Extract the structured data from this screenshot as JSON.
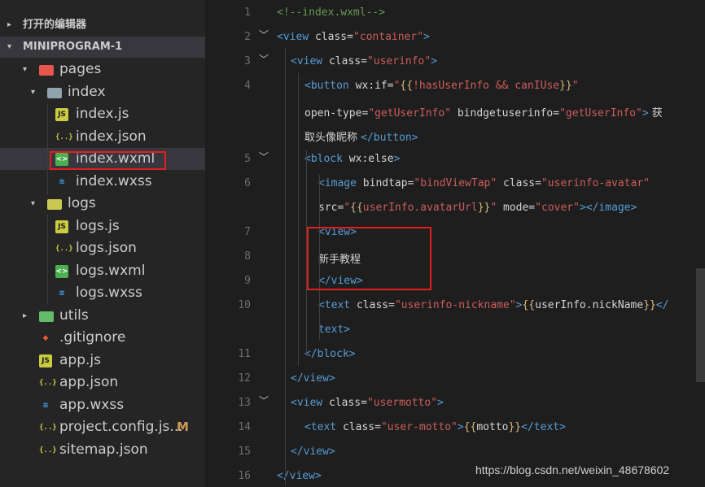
{
  "sidebar": {
    "open_editors_label": "打开的编辑器",
    "project_label": "MINIPROGRAM-1",
    "tree": [
      {
        "name": "pages",
        "kind": "folder-pages",
        "depth": 0,
        "arrow": "▾"
      },
      {
        "name": "index",
        "kind": "folder-index",
        "depth": 1,
        "arrow": "▾"
      },
      {
        "name": "index.js",
        "kind": "js",
        "depth": 2
      },
      {
        "name": "index.json",
        "kind": "json",
        "depth": 2
      },
      {
        "name": "index.wxml",
        "kind": "wxml",
        "depth": 2,
        "selected": true
      },
      {
        "name": "index.wxss",
        "kind": "css",
        "depth": 2
      },
      {
        "name": "logs",
        "kind": "folder-logs",
        "depth": 1,
        "arrow": "▾"
      },
      {
        "name": "logs.js",
        "kind": "js",
        "depth": 2
      },
      {
        "name": "logs.json",
        "kind": "json",
        "depth": 2
      },
      {
        "name": "logs.wxml",
        "kind": "wxml",
        "depth": 2
      },
      {
        "name": "logs.wxss",
        "kind": "css",
        "depth": 2
      },
      {
        "name": "utils",
        "kind": "folder-utils",
        "depth": 0,
        "arrow": "▸"
      },
      {
        "name": ".gitignore",
        "kind": "git",
        "depth": 0
      },
      {
        "name": "app.js",
        "kind": "js",
        "depth": 0
      },
      {
        "name": "app.json",
        "kind": "json",
        "depth": 0
      },
      {
        "name": "app.wxss",
        "kind": "css",
        "depth": 0
      },
      {
        "name": "project.config.js...",
        "kind": "json",
        "depth": 0,
        "badge": "M"
      },
      {
        "name": "sitemap.json",
        "kind": "json",
        "depth": 0
      }
    ]
  },
  "editor": {
    "lines": [
      {
        "num": "1",
        "fold": false,
        "indent": 0,
        "tokens": [
          [
            "c",
            "<!--index.wxml-->"
          ]
        ]
      },
      {
        "num": "2",
        "fold": true,
        "indent": 0,
        "tokens": [
          [
            "t",
            "<view "
          ],
          [
            "a",
            "class="
          ],
          [
            "s",
            "\"container\""
          ],
          [
            "t",
            ">"
          ]
        ]
      },
      {
        "num": "3",
        "fold": true,
        "indent": 1,
        "tokens": [
          [
            "t",
            "<view "
          ],
          [
            "a",
            "class="
          ],
          [
            "s",
            "\"userinfo\""
          ],
          [
            "t",
            ">"
          ]
        ]
      },
      {
        "num": "4",
        "fold": false,
        "indent": 2,
        "tokens": [
          [
            "t",
            "<button "
          ],
          [
            "a",
            "wx:if="
          ],
          [
            "s",
            "\""
          ],
          [
            "b",
            "{{"
          ],
          [
            "s",
            "!hasUserInfo && canIUse"
          ],
          [
            "b",
            "}}"
          ],
          [
            "s",
            "\""
          ]
        ]
      },
      {
        "num": "",
        "fold": false,
        "indent": 2,
        "tokens": [
          [
            "a",
            "open-type="
          ],
          [
            "s",
            "\"getUserInfo\""
          ],
          [
            "a",
            " bindgetuserinfo="
          ],
          [
            "s",
            "\"getUserInfo\""
          ],
          [
            "t",
            ">"
          ],
          [
            "x",
            " 获"
          ]
        ]
      },
      {
        "num": "",
        "fold": false,
        "indent": 2,
        "tokens": [
          [
            "x",
            "取头像昵称 "
          ],
          [
            "t",
            "</button>"
          ]
        ]
      },
      {
        "num": "5",
        "fold": true,
        "indent": 2,
        "tokens": [
          [
            "t",
            "<block "
          ],
          [
            "a",
            "wx:else"
          ],
          [
            "t",
            ">"
          ]
        ]
      },
      {
        "num": "6",
        "fold": false,
        "indent": 3,
        "tokens": [
          [
            "t",
            "<image "
          ],
          [
            "a",
            "bindtap="
          ],
          [
            "s",
            "\"bindViewTap\""
          ],
          [
            "a",
            " class="
          ],
          [
            "s",
            "\"userinfo-avatar\""
          ]
        ]
      },
      {
        "num": "",
        "fold": false,
        "indent": 3,
        "tokens": [
          [
            "a",
            "src="
          ],
          [
            "s",
            "\""
          ],
          [
            "b",
            "{{"
          ],
          [
            "s",
            "userInfo.avatarUrl"
          ],
          [
            "b",
            "}}"
          ],
          [
            "s",
            "\""
          ],
          [
            "a",
            " mode="
          ],
          [
            "s",
            "\"cover\""
          ],
          [
            "t",
            "></image>"
          ]
        ]
      },
      {
        "num": "7",
        "fold": false,
        "indent": 3,
        "tokens": [
          [
            "t",
            "<view>"
          ]
        ]
      },
      {
        "num": "8",
        "fold": false,
        "indent": 3,
        "tokens": [
          [
            "x",
            "新手教程"
          ]
        ]
      },
      {
        "num": "9",
        "fold": false,
        "indent": 3,
        "tokens": [
          [
            "t",
            "</view>"
          ]
        ]
      },
      {
        "num": "10",
        "fold": false,
        "indent": 3,
        "tokens": [
          [
            "t",
            "<text "
          ],
          [
            "a",
            "class="
          ],
          [
            "s",
            "\"userinfo-nickname\""
          ],
          [
            "t",
            ">"
          ],
          [
            "b",
            "{{"
          ],
          [
            "a",
            "userInfo.nickName"
          ],
          [
            "b",
            "}}"
          ],
          [
            "t",
            "</"
          ]
        ]
      },
      {
        "num": "",
        "fold": false,
        "indent": 3,
        "tokens": [
          [
            "t",
            "text>"
          ]
        ]
      },
      {
        "num": "11",
        "fold": false,
        "indent": 2,
        "tokens": [
          [
            "t",
            "</block>"
          ]
        ]
      },
      {
        "num": "12",
        "fold": false,
        "indent": 1,
        "tokens": [
          [
            "t",
            "</view>"
          ]
        ]
      },
      {
        "num": "13",
        "fold": true,
        "indent": 1,
        "tokens": [
          [
            "t",
            "<view "
          ],
          [
            "a",
            "class="
          ],
          [
            "s",
            "\"usermotto\""
          ],
          [
            "t",
            ">"
          ]
        ]
      },
      {
        "num": "14",
        "fold": false,
        "indent": 2,
        "tokens": [
          [
            "t",
            "<text "
          ],
          [
            "a",
            "class="
          ],
          [
            "s",
            "\"user-motto\""
          ],
          [
            "t",
            ">"
          ],
          [
            "b",
            "{{"
          ],
          [
            "a",
            "motto"
          ],
          [
            "b",
            "}}"
          ],
          [
            "t",
            "</text>"
          ]
        ]
      },
      {
        "num": "15",
        "fold": false,
        "indent": 1,
        "tokens": [
          [
            "t",
            "</view>"
          ]
        ]
      },
      {
        "num": "16",
        "fold": false,
        "indent": 0,
        "tokens": [
          [
            "t",
            "</view>"
          ]
        ]
      }
    ]
  },
  "watermark": "https://blog.csdn.net/weixin_48678602"
}
